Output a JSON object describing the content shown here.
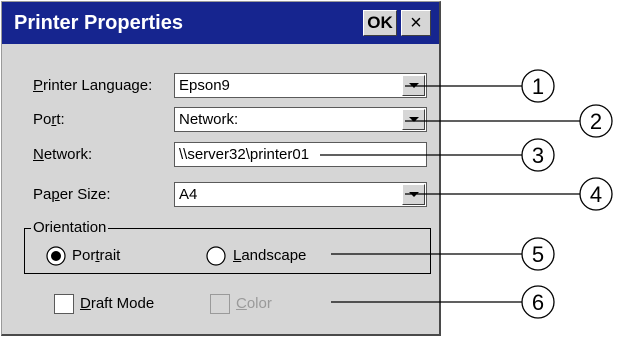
{
  "dialog": {
    "title": "Printer Properties",
    "ok_label": "OK",
    "close_label": "×"
  },
  "fields": {
    "printer_language": {
      "label_pre": "",
      "label_u": "P",
      "label_post": "rinter Language:",
      "value": "Epson9"
    },
    "port": {
      "label_pre": "Po",
      "label_u": "r",
      "label_post": "t:",
      "value": "Network:"
    },
    "network": {
      "label_pre": "",
      "label_u": "N",
      "label_post": "etwork:",
      "value": "\\\\server32\\printer01"
    },
    "paper_size": {
      "label_pre": "Pa",
      "label_u": "p",
      "label_post": "er Size:",
      "value": "A4"
    }
  },
  "orientation": {
    "legend": "Orientation",
    "portrait": {
      "pre": "Por",
      "u": "t",
      "post": "rait",
      "selected": true
    },
    "landscape": {
      "pre": "",
      "u": "L",
      "post": "andscape",
      "selected": false
    }
  },
  "options": {
    "draft_mode": {
      "pre": "",
      "u": "D",
      "post": "raft Mode",
      "checked": false,
      "enabled": true
    },
    "color": {
      "pre": "",
      "u": "C",
      "post": "olor",
      "checked": false,
      "enabled": false
    }
  },
  "callouts": [
    "1",
    "2",
    "3",
    "4",
    "5",
    "6"
  ],
  "colors": {
    "titlebar": "#16258f",
    "dialog_bg": "#d6d6d6",
    "field_bg": "#ffffff",
    "disabled_text": "#9a9a9a"
  },
  "icons": {
    "dropdown": "chevron-down-icon",
    "close": "close-icon"
  }
}
